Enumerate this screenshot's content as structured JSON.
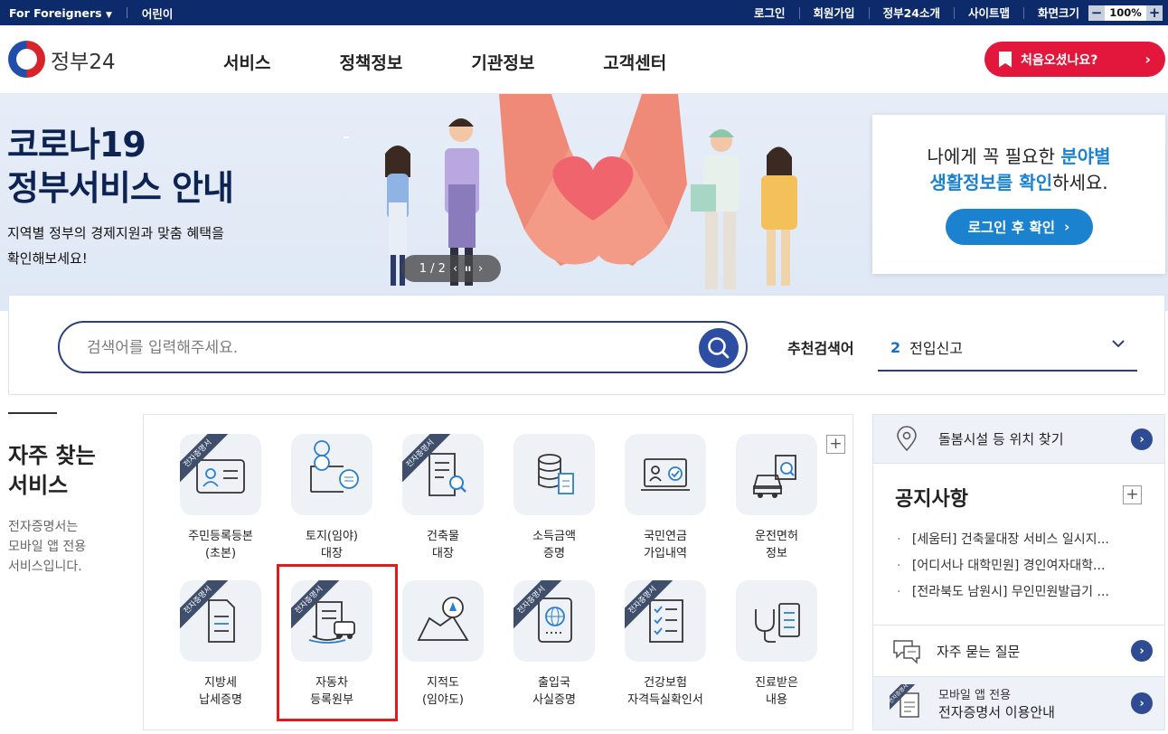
{
  "topbar": {
    "foreigners": "For Foreigners",
    "foreigners_caret": "▼",
    "kids": "어린이",
    "links": [
      "로그인",
      "회원가입",
      "정부24소개",
      "사이트맵",
      "화면크기"
    ],
    "zoom_minus": "−",
    "zoom_value": "100%",
    "zoom_plus": "+"
  },
  "header": {
    "logo_text": "정부24",
    "nav": [
      "서비스",
      "정책정보",
      "기관정보",
      "고객센터"
    ],
    "first_visit": "처음오셨나요?",
    "first_visit_chev": "›"
  },
  "banner": {
    "title_line1": "코로나19",
    "title_line2": "정부서비스 안내",
    "sub_line1": "지역별 정부의 경제지원과 맞춤 혜택을",
    "sub_line2": "확인해보세요!",
    "pager": "1 / 2",
    "pager_prev": "‹",
    "pager_pause": "ıı",
    "pager_next": "›",
    "card": {
      "l1_a": "나에게 꼭 필요한 ",
      "l1_b": "분야별",
      "l2_a": "생활정보를 확인",
      "l2_b": "하세요.",
      "button": "로그인 후 확인",
      "button_chev": "›"
    }
  },
  "search": {
    "placeholder": "검색어를 입력해주세요.",
    "rec_label": "추천검색어",
    "rec_num": "2",
    "rec_value": "전입신고"
  },
  "frequent": {
    "title_line1": "자주 찾는",
    "title_line2": "서비스",
    "desc_line1": "전자증명서는",
    "desc_line2": "모바일 앱 전용",
    "desc_line3": "서비스입니다.",
    "plus": "+",
    "ribbon": "전자증명서",
    "tiles": [
      {
        "l1": "주민등록등본",
        "l2": "(초본)",
        "icon": "id-card-icon",
        "ribbon": true
      },
      {
        "l1": "토지(임야)",
        "l2": "대장",
        "icon": "land-map-icon",
        "ribbon": false
      },
      {
        "l1": "건축물",
        "l2": "대장",
        "icon": "building-doc-icon",
        "ribbon": true
      },
      {
        "l1": "소득금액",
        "l2": "증명",
        "icon": "income-coins-icon",
        "ribbon": false
      },
      {
        "l1": "국민연금",
        "l2": "가입내역",
        "icon": "pension-monitor-icon",
        "ribbon": false
      },
      {
        "l1": "운전면허",
        "l2": "정보",
        "icon": "driver-license-icon",
        "ribbon": false
      },
      {
        "l1": "지방세",
        "l2": "납세증명",
        "icon": "tax-doc-icon",
        "ribbon": true
      },
      {
        "l1": "자동차",
        "l2": "등록원부",
        "icon": "car-registration-icon",
        "ribbon": true
      },
      {
        "l1": "지적도",
        "l2": "(임야도)",
        "icon": "compass-map-icon",
        "ribbon": false
      },
      {
        "l1": "출입국",
        "l2": "사실증명",
        "icon": "passport-icon",
        "ribbon": true
      },
      {
        "l1": "건강보험",
        "l2": "자격득실확인서",
        "icon": "checklist-icon",
        "ribbon": true
      },
      {
        "l1": "진료받은",
        "l2": "내용",
        "icon": "stethoscope-icon",
        "ribbon": false
      }
    ]
  },
  "sidebar": {
    "care_facility": "돌봄시설 등 위치 찾기",
    "notice_title": "공지사항",
    "notice_plus": "+",
    "notices": [
      "[세움터] 건축물대장 서비스 일시지...",
      "[어디서나 대학민원] 경인여자대학...",
      "[전라북도 남원시] 무인민원발급기 ..."
    ],
    "faq": "자주 묻는 질문",
    "mobile_line1": "모바일 앱 전용",
    "mobile_line2": "전자증명서 이용안내",
    "mobile_ribbon": "전자증명서",
    "arrow": "›"
  }
}
